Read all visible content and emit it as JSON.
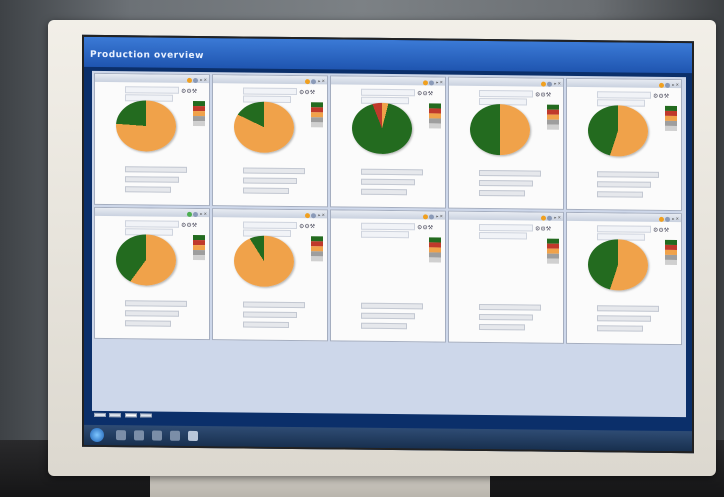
{
  "scene": {
    "colors": {
      "orange": "#f0a24a",
      "green": "#236b1f",
      "red": "#c0392b",
      "grey": "#9e9e9e"
    }
  },
  "app": {
    "title": "Production overview",
    "menu": [
      "",
      "",
      ""
    ]
  },
  "panels": [
    {
      "pie_orange_pct": 76,
      "pie_green_pct": 24,
      "pie": true
    },
    {
      "pie_orange_pct": 82,
      "pie_green_pct": 18,
      "pie": true
    },
    {
      "pie_orange_pct": 4,
      "pie_green_pct": 90,
      "pie_red_pct": 6,
      "pie": true
    },
    {
      "pie_orange_pct": 50,
      "pie_green_pct": 50,
      "pie": true
    },
    {
      "pie_orange_pct": 55,
      "pie_green_pct": 45,
      "pie": true
    },
    {
      "pie_orange_pct": 60,
      "pie_green_pct": 40,
      "pie": true
    },
    {
      "pie_orange_pct": 91,
      "pie_green_pct": 9,
      "pie": true
    },
    {
      "pie": false
    },
    {
      "pie": false
    },
    {
      "pie_orange_pct": 55,
      "pie_green_pct": 45,
      "pie": true
    }
  ],
  "tabs": [
    "",
    "",
    "",
    ""
  ]
}
